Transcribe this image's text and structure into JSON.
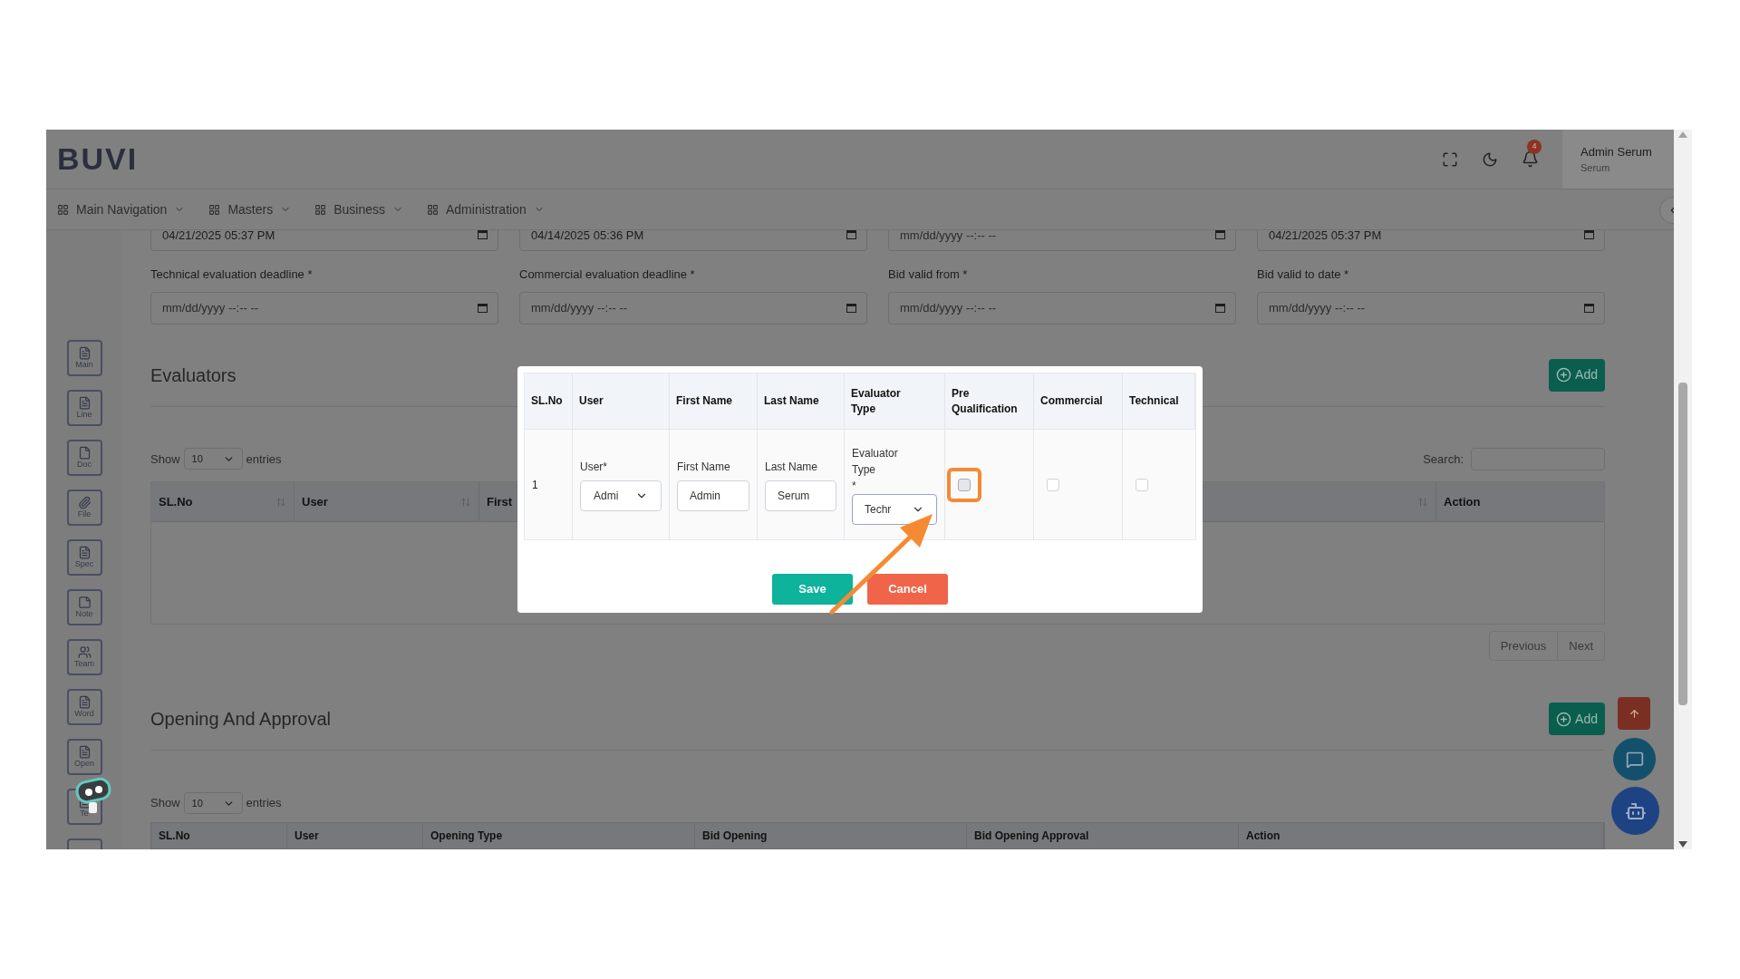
{
  "header": {
    "logo": "BUVI",
    "notification_count": "4",
    "user_name": "Admin Serum",
    "user_role": "Serum"
  },
  "nav": [
    {
      "label": "Main Navigation"
    },
    {
      "label": "Masters"
    },
    {
      "label": "Business"
    },
    {
      "label": "Administration"
    }
  ],
  "sidebar": [
    {
      "label": "Main"
    },
    {
      "label": "Line"
    },
    {
      "label": "Doc"
    },
    {
      "label": "File"
    },
    {
      "label": "Spec"
    },
    {
      "label": "Note"
    },
    {
      "label": "Team"
    },
    {
      "label": "Word"
    },
    {
      "label": "Open"
    },
    {
      "label": "Te"
    }
  ],
  "dates_top": [
    {
      "value": "04/21/2025 05:37 PM"
    },
    {
      "value": "04/14/2025 05:36 PM"
    },
    {
      "placeholder": "mm/dd/yyyy --:-- --"
    },
    {
      "value": "04/21/2025 05:37 PM"
    }
  ],
  "dates": [
    {
      "label": "Technical evaluation deadline *",
      "placeholder": "mm/dd/yyyy --:-- --"
    },
    {
      "label": "Commercial evaluation deadline *",
      "placeholder": "mm/dd/yyyy --:-- --"
    },
    {
      "label": "Bid valid from *",
      "placeholder": "mm/dd/yyyy --:-- --"
    },
    {
      "label": "Bid valid to date *",
      "placeholder": "mm/dd/yyyy --:-- --"
    }
  ],
  "evaluators": {
    "title": "Evaluators",
    "add_label": "Add",
    "show": "Show",
    "page_size": "10",
    "entries": "entries",
    "search_label": "Search:",
    "columns_left": [
      "SL.No",
      "User",
      "First"
    ],
    "columns_right": [
      "Action"
    ],
    "pagination": [
      "Previous",
      "Next"
    ]
  },
  "opening": {
    "title": "Opening And Approval",
    "add_label": "Add",
    "show": "Show",
    "page_size": "10",
    "entries": "entries",
    "columns": [
      "SL.No",
      "User",
      "Opening Type",
      "Bid Opening",
      "Bid Opening Approval",
      "Action"
    ]
  },
  "modal": {
    "columns": [
      "SL.No",
      "User",
      "First Name",
      "Last Name",
      "Evaluator Type",
      "Pre Qualification",
      "Commercial",
      "Technical"
    ],
    "row": {
      "sl": "1",
      "user_label": "User*",
      "user_value": "Admi",
      "first_name_label": "First Name",
      "first_name": "Admin",
      "last_name_label": "Last Name",
      "last_name": "Serum",
      "type_label": "Evaluator Type",
      "type_required": "*",
      "type_value": "Techr",
      "checks": [
        {
          "checked": false,
          "highlighted": true
        },
        {
          "checked": false,
          "highlighted": false
        },
        {
          "checked": false,
          "highlighted": false
        }
      ]
    },
    "buttons": [
      {
        "label": "Save",
        "kind": "primary"
      },
      {
        "label": "Cancel",
        "kind": "danger"
      }
    ]
  }
}
